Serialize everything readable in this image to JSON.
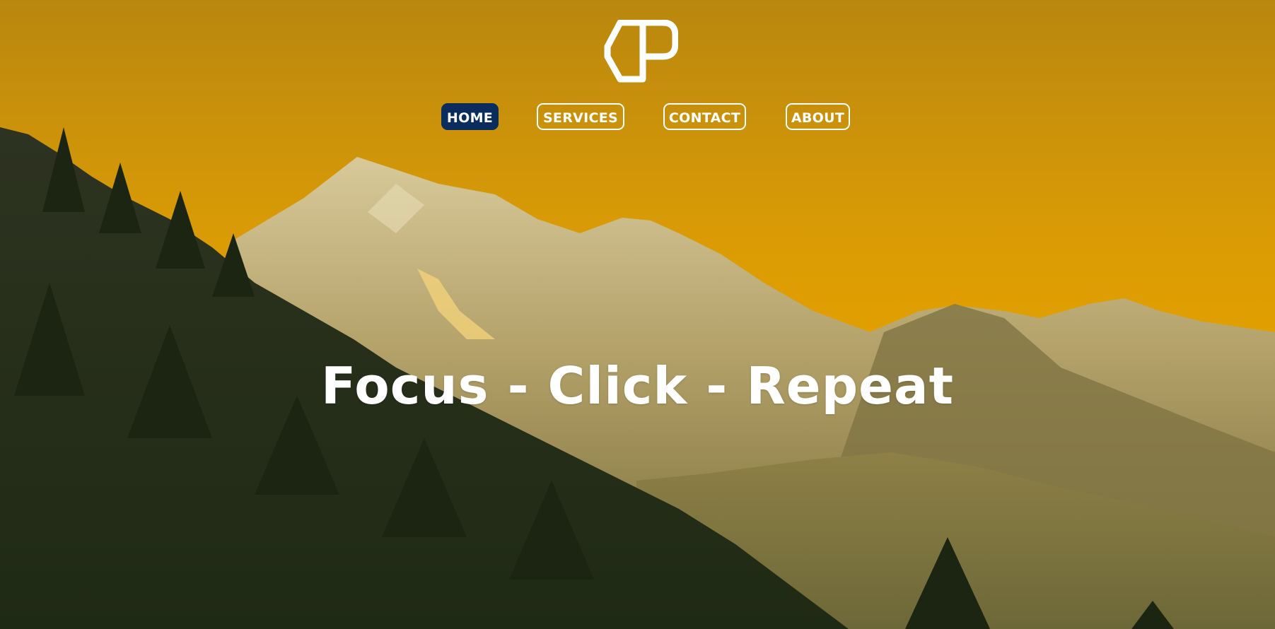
{
  "logo": {
    "icon": "cp-monogram-logo-icon"
  },
  "nav": {
    "items": [
      {
        "label": "HOME",
        "active": true
      },
      {
        "label": "SERVICES",
        "active": false
      },
      {
        "label": "CONTACT",
        "active": false
      },
      {
        "label": "ABOUT",
        "active": false
      }
    ]
  },
  "hero": {
    "headline": "Focus - Click - Repeat",
    "background_image": "mountain-sunset-forest-photo"
  },
  "colors": {
    "sky": "#e19f02",
    "nav_active": "#0b2d5e",
    "text": "#ffffff"
  }
}
